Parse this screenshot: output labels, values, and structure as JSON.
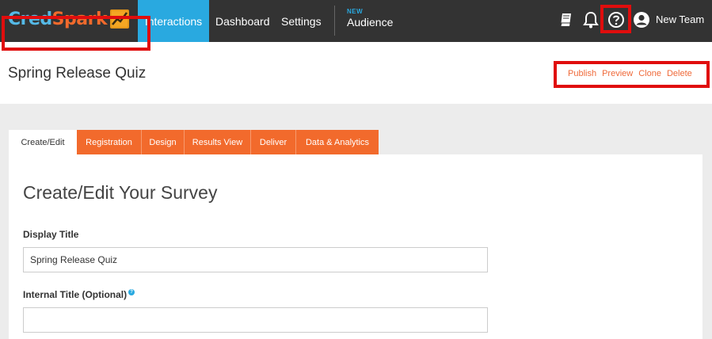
{
  "brand": {
    "part1": "Cred",
    "part2": "Spark"
  },
  "nav": {
    "interactions": "Interactions",
    "dashboard": "Dashboard",
    "settings": "Settings",
    "audience_badge": "NEW",
    "audience": "Audience",
    "team": "New Team",
    "icons": [
      "book-icon",
      "bell-icon",
      "help-icon",
      "user-icon"
    ]
  },
  "header": {
    "title": "Spring Release Quiz",
    "actions": [
      "Publish",
      "Preview",
      "Clone",
      "Delete"
    ]
  },
  "tabs": [
    "Create/Edit",
    "Registration",
    "Design",
    "Results View",
    "Deliver",
    "Data & Analytics"
  ],
  "form": {
    "heading": "Create/Edit Your Survey",
    "display_title_label": "Display Title",
    "display_title_value": "Spring Release Quiz",
    "internal_title_label": "Internal Title (Optional)",
    "internal_title_value": ""
  },
  "colors": {
    "nav_bg": "#333333",
    "accent_blue": "#29a9e0",
    "accent_orange": "#f26a2c",
    "highlight_red": "#e00d0d"
  }
}
